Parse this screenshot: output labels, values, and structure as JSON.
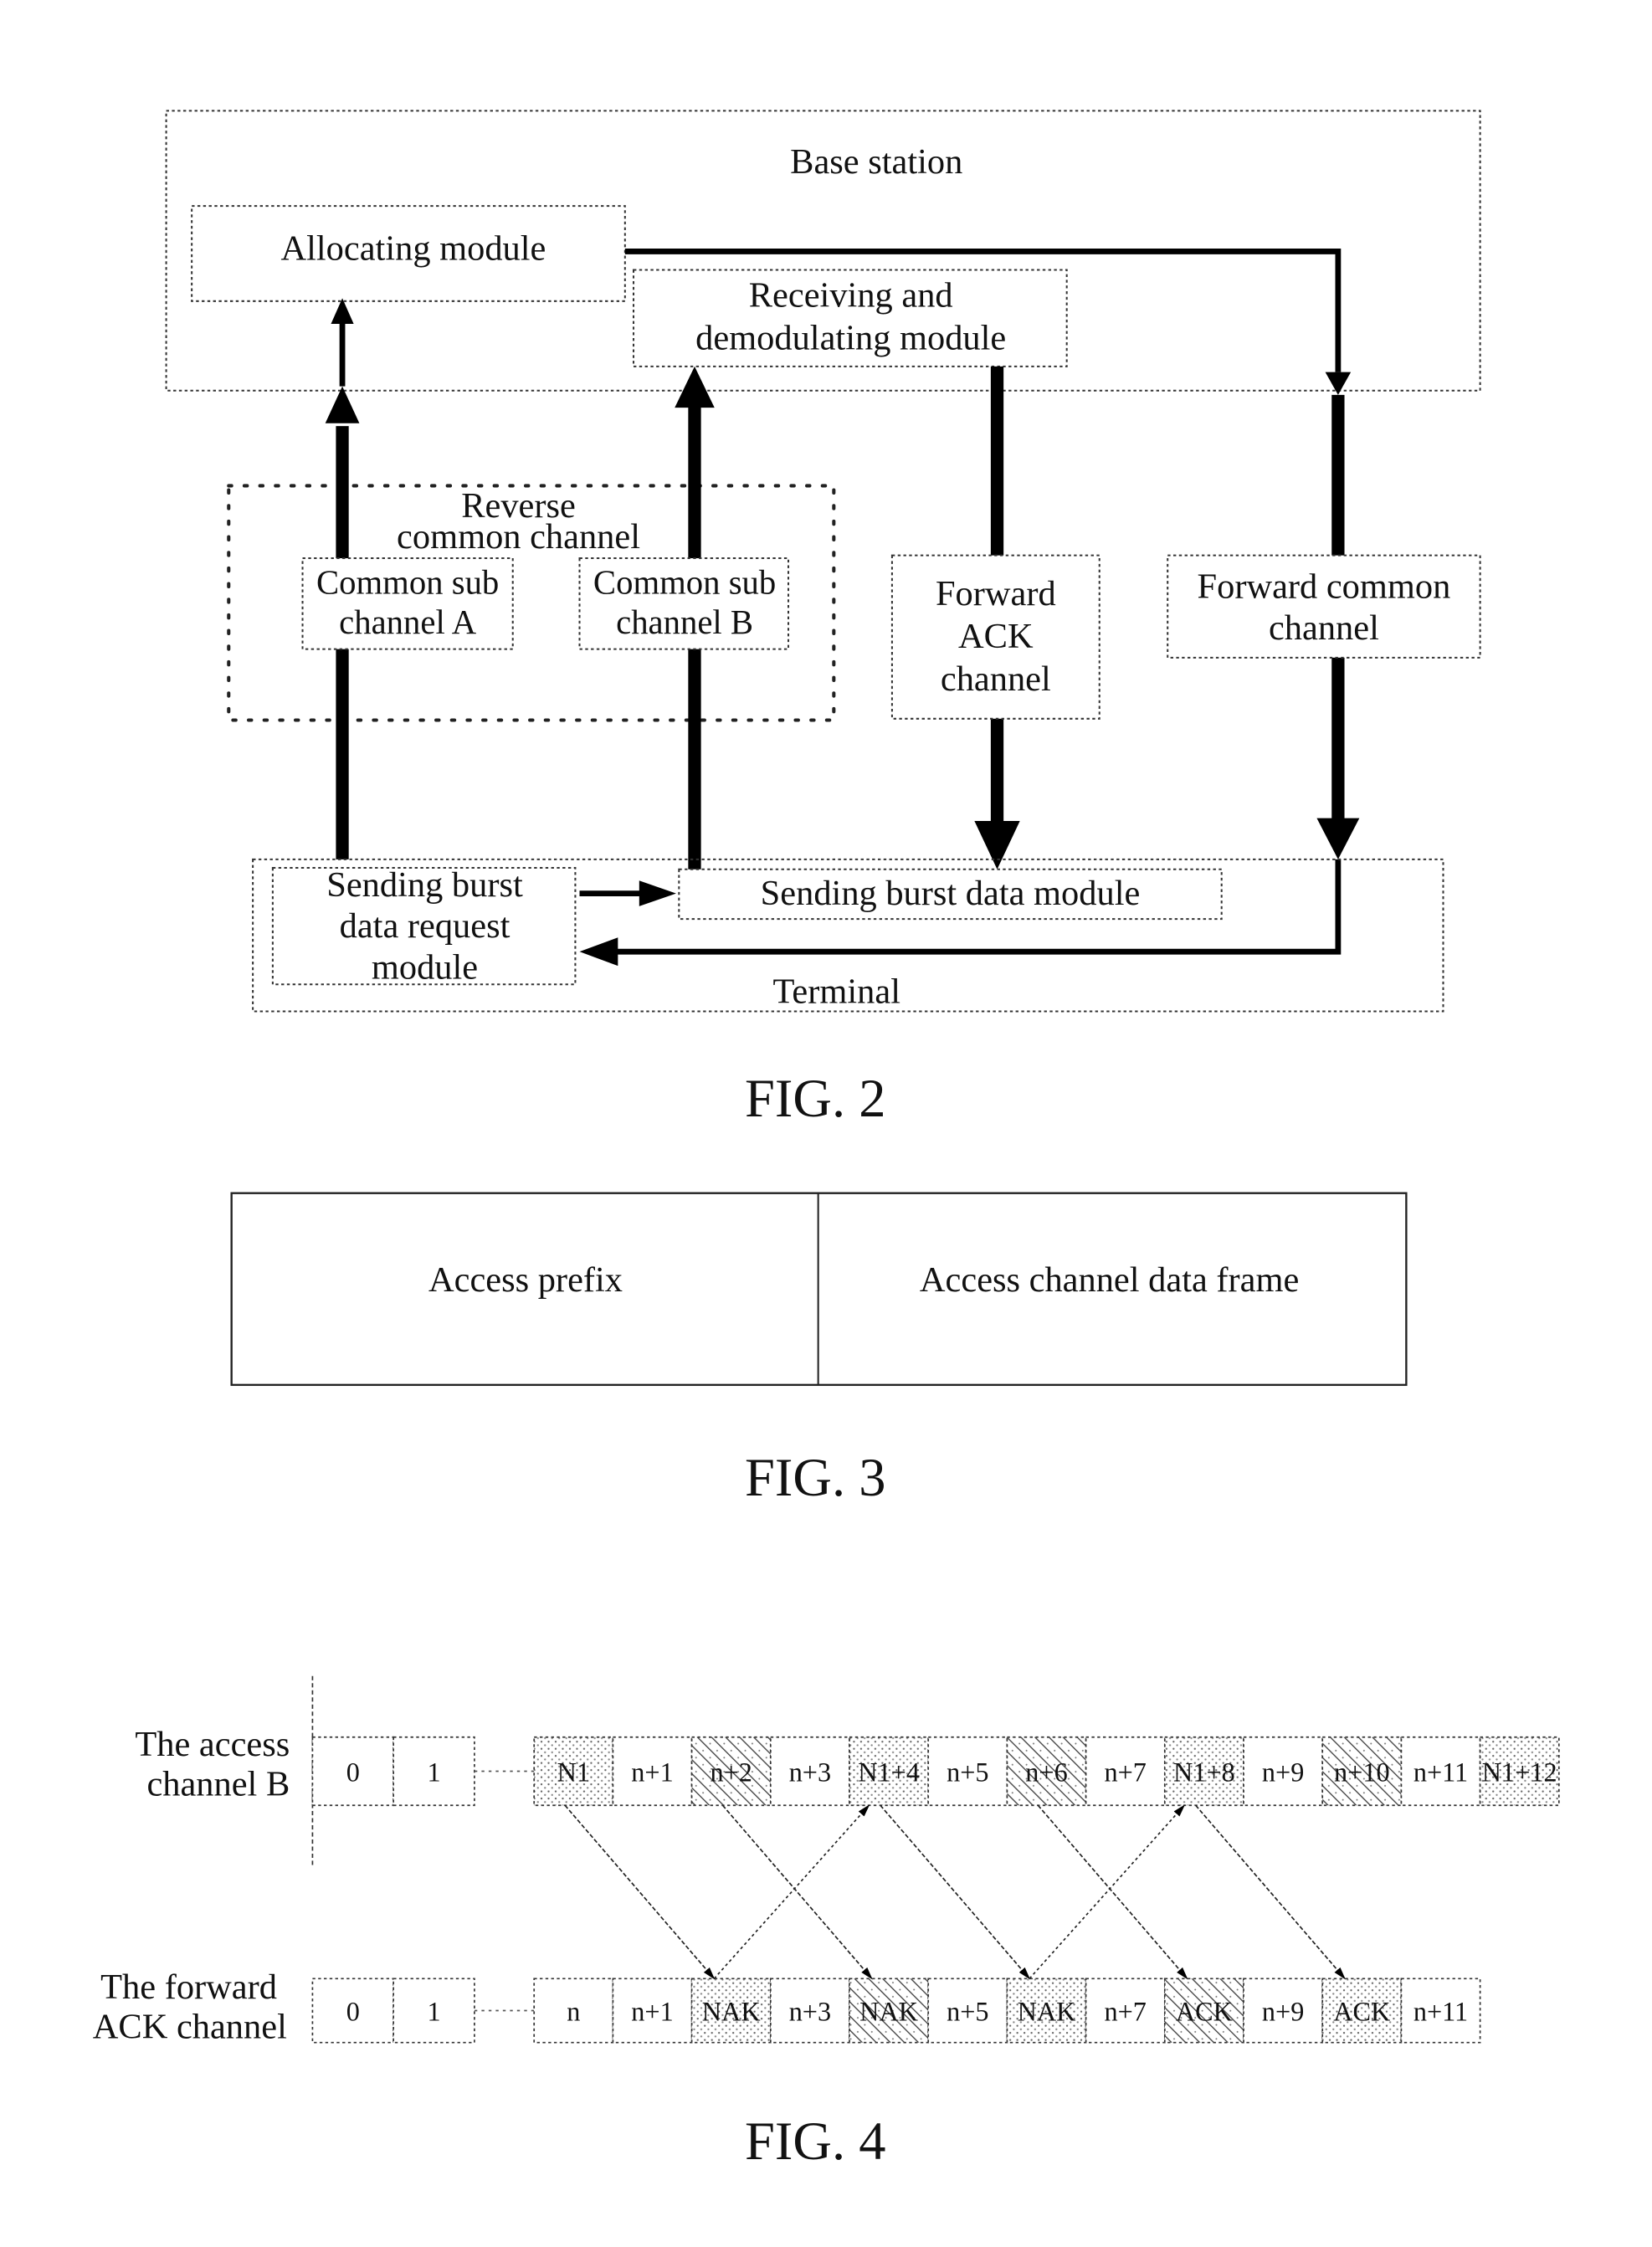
{
  "fig2": {
    "caption": "FIG. 2",
    "base_station": "Base station",
    "allocating_module": "Allocating module",
    "receiving_module": [
      "Receiving and",
      "demodulating module"
    ],
    "reverse_common_channel": [
      "Reverse",
      "common channel"
    ],
    "common_sub_channel_a": [
      "Common sub",
      "channel A"
    ],
    "common_sub_channel_b": [
      "Common sub",
      "channel B"
    ],
    "forward_ack_channel": [
      "Forward",
      "ACK",
      "channel"
    ],
    "forward_common_channel": [
      "Forward common",
      "channel"
    ],
    "sending_burst_request_module": [
      "Sending burst",
      "data request",
      "module"
    ],
    "sending_burst_data_module": "Sending burst data module",
    "terminal": "Terminal"
  },
  "fig3": {
    "caption": "FIG. 3",
    "fields": [
      "Access prefix",
      "Access channel data frame"
    ]
  },
  "fig4": {
    "caption": "FIG. 4",
    "access_channel_label": [
      "The access",
      "channel B"
    ],
    "forward_ack_label": [
      "The forward",
      "ACK channel"
    ],
    "access_channel_leading_slots": [
      "0",
      "1"
    ],
    "access_channel_slots": [
      {
        "label": "N1",
        "pattern": "dots"
      },
      {
        "label": "n+1",
        "pattern": "none"
      },
      {
        "label": "n+2",
        "pattern": "hatch"
      },
      {
        "label": "n+3",
        "pattern": "none"
      },
      {
        "label": "N1+4",
        "pattern": "dots"
      },
      {
        "label": "n+5",
        "pattern": "none"
      },
      {
        "label": "n+6",
        "pattern": "hatch"
      },
      {
        "label": "n+7",
        "pattern": "none"
      },
      {
        "label": "N1+8",
        "pattern": "dots"
      },
      {
        "label": "n+9",
        "pattern": "none"
      },
      {
        "label": "n+10",
        "pattern": "hatch"
      },
      {
        "label": "n+11",
        "pattern": "none"
      },
      {
        "label": "N1+12",
        "pattern": "dots"
      }
    ],
    "forward_ack_leading_slots": [
      "0",
      "1"
    ],
    "forward_ack_slots": [
      {
        "label": "n",
        "pattern": "none"
      },
      {
        "label": "n+1",
        "pattern": "none"
      },
      {
        "label": "NAK",
        "pattern": "dots"
      },
      {
        "label": "n+3",
        "pattern": "none"
      },
      {
        "label": "NAK",
        "pattern": "hatch"
      },
      {
        "label": "n+5",
        "pattern": "none"
      },
      {
        "label": "NAK",
        "pattern": "dots"
      },
      {
        "label": "n+7",
        "pattern": "none"
      },
      {
        "label": "ACK",
        "pattern": "hatch"
      },
      {
        "label": "n+9",
        "pattern": "none"
      },
      {
        "label": "ACK",
        "pattern": "dots"
      },
      {
        "label": "n+11",
        "pattern": "none"
      }
    ],
    "links_down": [
      [
        0,
        2
      ],
      [
        2,
        4
      ],
      [
        4,
        6
      ],
      [
        6,
        8
      ],
      [
        8,
        10
      ]
    ],
    "links_up": [
      [
        2,
        4
      ],
      [
        6,
        8
      ]
    ]
  }
}
